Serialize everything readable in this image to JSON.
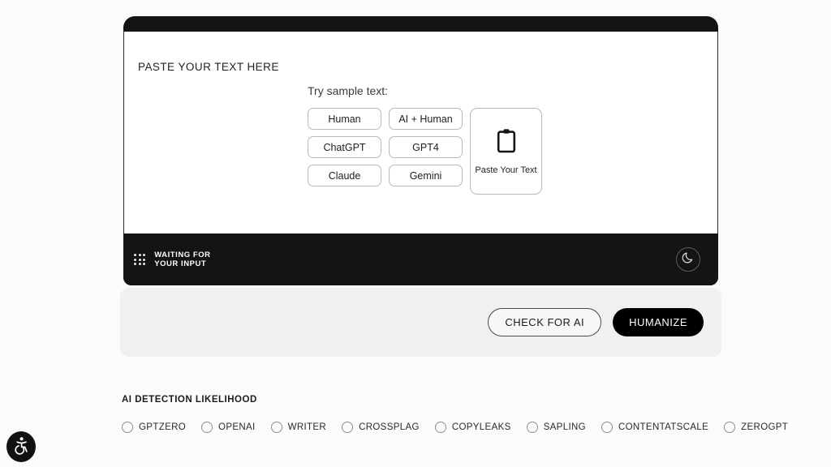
{
  "editor": {
    "paste_heading": "PASTE YOUR TEXT HERE",
    "sample_label": "Try sample text:",
    "sample_buttons_col1": [
      "Human",
      "ChatGPT",
      "Claude"
    ],
    "sample_buttons_col2": [
      "AI + Human",
      "GPT4",
      "Gemini"
    ],
    "paste_card": {
      "icon": "clipboard-icon",
      "label": "Paste Your Text"
    }
  },
  "status_bar": {
    "icon": "dot-grid-icon",
    "line1": "WAITING FOR",
    "line2": "YOUR INPUT",
    "theme_toggle_icon": "moon-icon"
  },
  "actions": {
    "check_label": "CHECK FOR AI",
    "humanize_label": "HUMANIZE"
  },
  "detection": {
    "title": "AI DETECTION LIKELIHOOD",
    "items": [
      {
        "label": "GPTZERO"
      },
      {
        "label": "OPENAI"
      },
      {
        "label": "WRITER"
      },
      {
        "label": "CROSSPLAG"
      },
      {
        "label": "COPYLEAKS"
      },
      {
        "label": "SAPLING"
      },
      {
        "label": "CONTENTATSCALE"
      },
      {
        "label": "ZEROGPT"
      }
    ]
  },
  "accessibility": {
    "icon": "accessibility-icon"
  },
  "colors": {
    "panel_dark": "#141414",
    "surface": "#ffffff",
    "page_background": "#fbfbfb",
    "action_card": "#f0f0f0",
    "humanize_button": "#000000",
    "chip_border": "#b9b9b9"
  }
}
